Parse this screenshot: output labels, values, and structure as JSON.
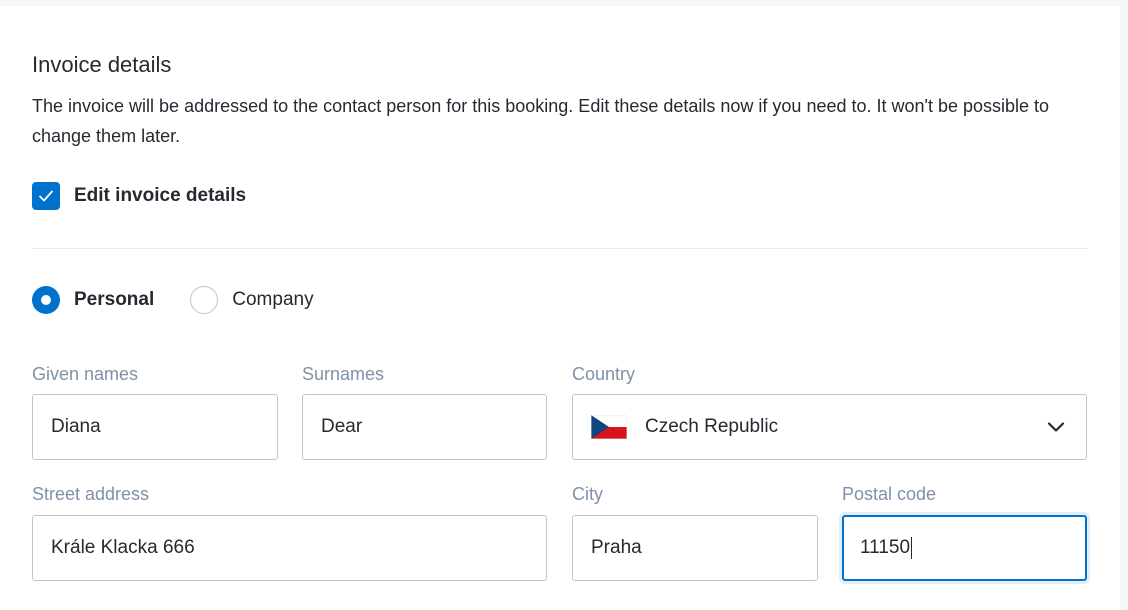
{
  "section": {
    "title": "Invoice details",
    "description": "The invoice will be addressed to the contact person for this booking. Edit these details now if you need to. It won't be possible to change them later."
  },
  "edit_checkbox": {
    "label": "Edit invoice details",
    "checked": true
  },
  "invoice_type": {
    "options": [
      {
        "label": "Personal",
        "selected": true
      },
      {
        "label": "Company",
        "selected": false
      }
    ]
  },
  "form": {
    "given_names": {
      "label": "Given names",
      "value": "Diana"
    },
    "surnames": {
      "label": "Surnames",
      "value": "Dear"
    },
    "country": {
      "label": "Country",
      "value": "Czech Republic",
      "flag_icon": "czech-flag-icon"
    },
    "street_address": {
      "label": "Street address",
      "value": "Krále Klacka 666"
    },
    "city": {
      "label": "City",
      "value": "Praha"
    },
    "postal_code": {
      "label": "Postal code",
      "value": "11150"
    }
  },
  "colors": {
    "accent": "#0172cb",
    "label": "#7f91a8",
    "border": "#bac7d5",
    "text": "#252a31"
  }
}
